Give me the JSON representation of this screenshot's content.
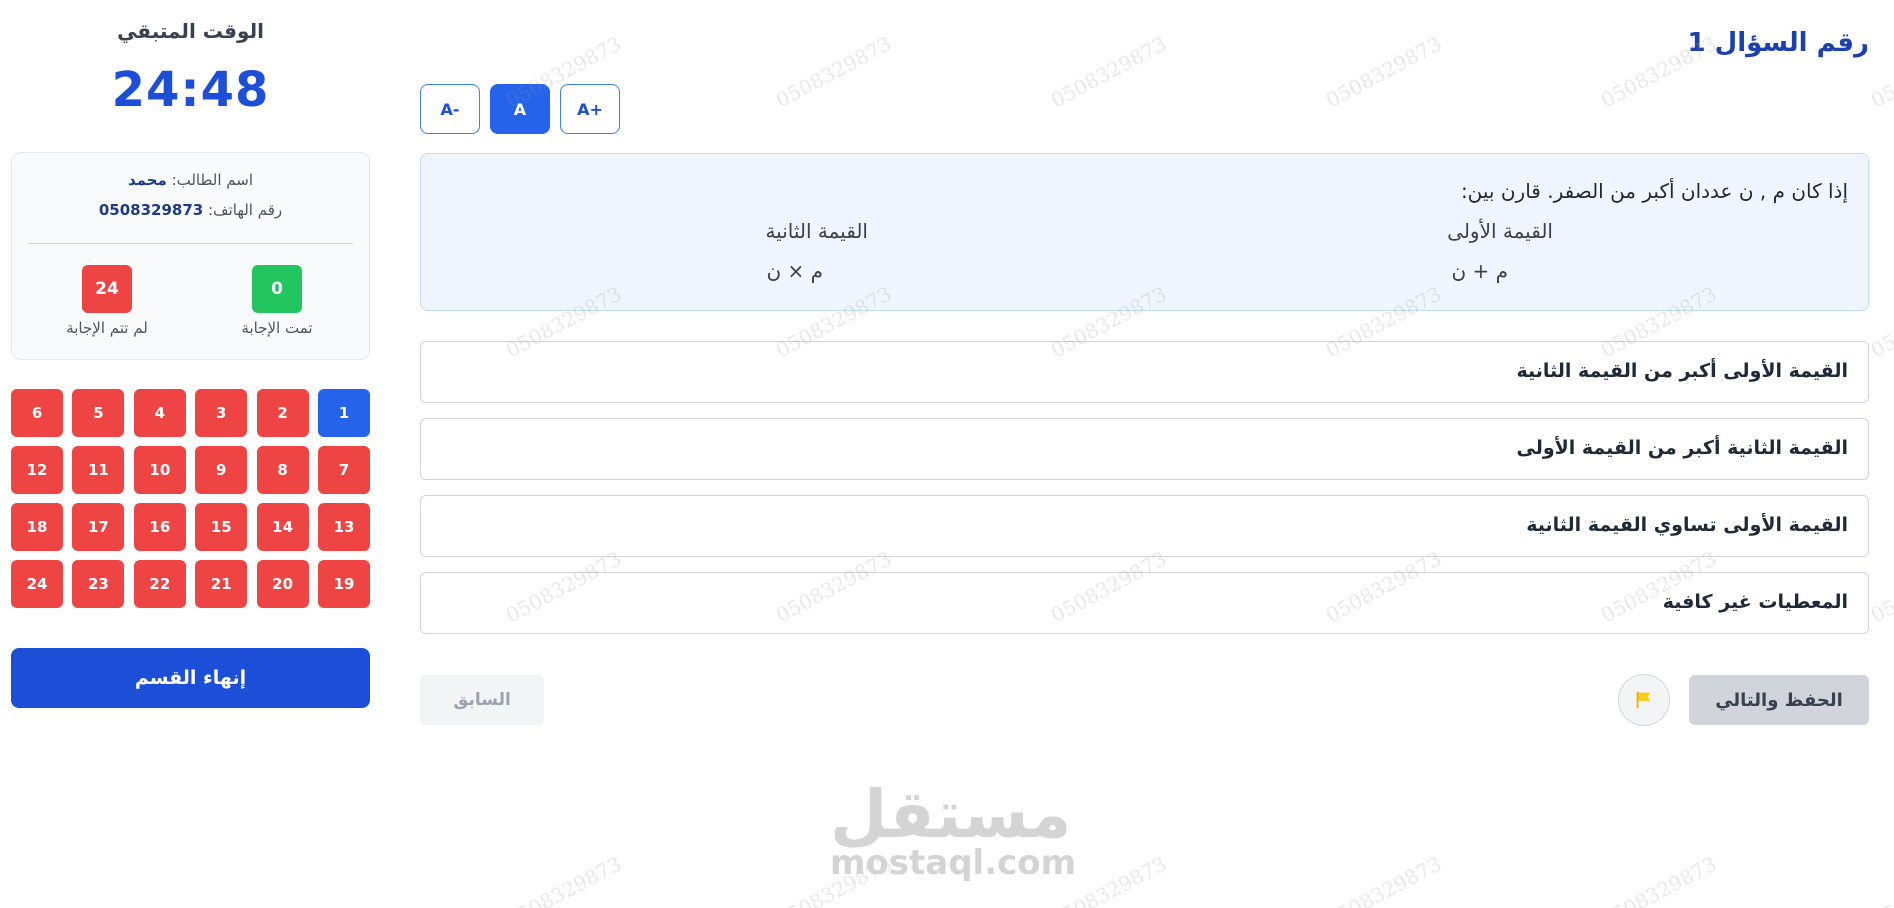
{
  "sidebar": {
    "timer_title": "الوقت المتبقي",
    "timer_value": "24:48",
    "student": {
      "name_label": "اسم الطالب:",
      "name_value": "محمد",
      "phone_label": "رقم الهاتف:",
      "phone_value": "0508329873"
    },
    "stats": {
      "answered_count": "0",
      "answered_label": "تمت الإجابة",
      "unanswered_count": "24",
      "unanswered_label": "لم تتم الإجابة"
    },
    "question_numbers": [
      "1",
      "2",
      "3",
      "4",
      "5",
      "6",
      "7",
      "8",
      "9",
      "10",
      "11",
      "12",
      "13",
      "14",
      "15",
      "16",
      "17",
      "18",
      "19",
      "20",
      "21",
      "22",
      "23",
      "24"
    ],
    "current_question": "1",
    "end_section_label": "إنهاء القسم"
  },
  "main": {
    "question_title": "رقم السؤال 1",
    "font_controls": {
      "decrease": "A-",
      "normal": "A",
      "increase": "A+"
    },
    "question": {
      "text": "إذا كان م , ن عددان أكبر من الصفر. قارن بين:",
      "first_label": "القيمة الأولى",
      "second_label": "القيمة الثانية",
      "first_value": "م + ن",
      "second_value": "م × ن"
    },
    "options": [
      "القيمة الأولى أكبر من القيمة الثانية",
      "القيمة الثانية أكبر من القيمة الأولى",
      "القيمة الأولى تساوي القيمة الثانية",
      "المعطيات غير كافية"
    ],
    "previous_label": "السابق",
    "save_next_label": "الحفظ والتالي",
    "flag_icon": "flag-icon",
    "flag_color": "#facc15"
  },
  "watermark": {
    "text": "0508329873",
    "logo_arabic": "مستقل",
    "logo_latin": "mostaql.com"
  },
  "colors": {
    "primary": "#1d4ed8",
    "unanswered": "#ef4444",
    "answered": "#22c55e",
    "question_bg": "#eff6ff"
  }
}
